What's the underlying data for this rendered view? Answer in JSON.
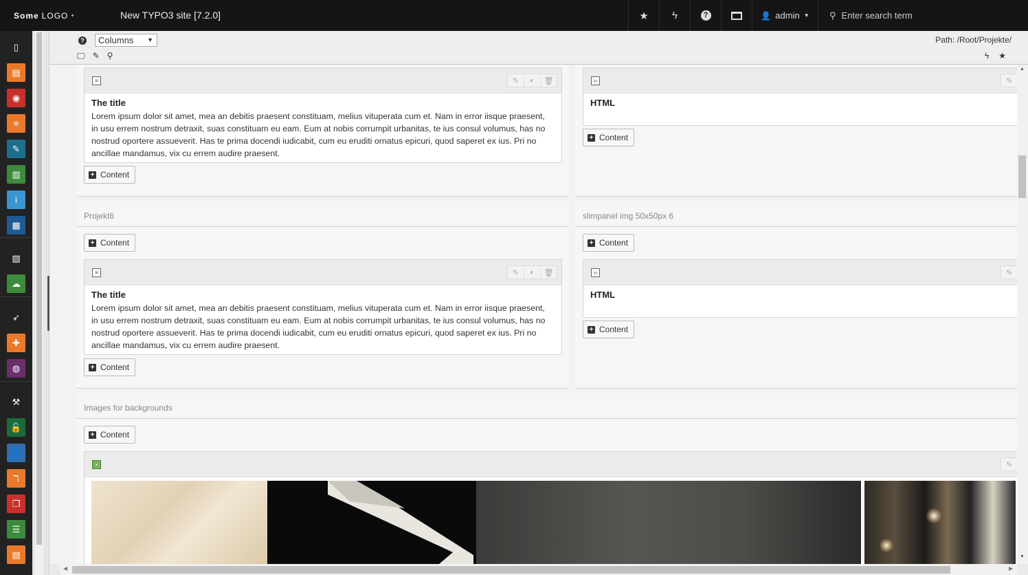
{
  "topbar": {
    "logo_bold": "Some",
    "logo_rest": "LOGO",
    "logo_mark": "+",
    "site_title": "New TYPO3 site [7.2.0]",
    "icons": [
      "star-icon",
      "bolt-icon",
      "help-icon",
      "list-icon"
    ],
    "user_name": "admin",
    "search_placeholder": "Enter search term"
  },
  "docheader": {
    "help": "?",
    "view_select": "Columns",
    "path": "Path: /Root/Projekte/",
    "left_icons": [
      "desktop-icon",
      "pencil-icon",
      "search-icon"
    ],
    "right_icons": [
      "bolt-icon",
      "star-icon"
    ]
  },
  "modules": [
    {
      "name": "page-module",
      "color": "#ffffff",
      "bg": "#222222",
      "glyph": "▯"
    },
    {
      "name": "view-module",
      "color": "#ffffff",
      "bg": "#e97a2b",
      "glyph": "▤"
    },
    {
      "name": "preview-module",
      "color": "#ffffff",
      "bg": "#c9302c",
      "glyph": "◉"
    },
    {
      "name": "list-module",
      "color": "#ffffff",
      "bg": "#e97a2b",
      "glyph": "≡"
    },
    {
      "name": "wizard-module",
      "color": "#ffffff",
      "bg": "#1e6e8c",
      "glyph": "✎"
    },
    {
      "name": "reports-module",
      "color": "#ffffff",
      "bg": "#3d8b3d",
      "glyph": "▥"
    },
    {
      "name": "info-module",
      "color": "#ffffff",
      "bg": "#3a95d1",
      "glyph": "i"
    },
    {
      "name": "template-module",
      "color": "#ffffff",
      "bg": "#1e5b94",
      "glyph": "▦"
    },
    {
      "name": "filelist-module",
      "color": "#ffffff",
      "bg": "#222222",
      "glyph": "▨"
    },
    {
      "name": "cloud-module",
      "color": "#ffffff",
      "bg": "#3d8b3d",
      "glyph": "☁"
    },
    {
      "name": "launch-module",
      "color": "#ffffff",
      "bg": "#222222",
      "glyph": "➶"
    },
    {
      "name": "extension-module",
      "color": "#ffffff",
      "bg": "#e97a2b",
      "glyph": "✚"
    },
    {
      "name": "globe-module",
      "color": "#ffffff",
      "bg": "#6b2f6b",
      "glyph": "◍"
    },
    {
      "name": "plugin-module",
      "color": "#ffffff",
      "bg": "#222222",
      "glyph": "⚒"
    },
    {
      "name": "access-module",
      "color": "#ffffff",
      "bg": "#1b6b3b",
      "glyph": "🔓"
    },
    {
      "name": "users-module",
      "color": "#ffffff",
      "bg": "#2f6fb0",
      "glyph": "👤"
    },
    {
      "name": "typo3-module",
      "color": "#ffffff",
      "bg": "#e97a2b",
      "glyph": "ℸ"
    },
    {
      "name": "docs-module",
      "color": "#ffffff",
      "bg": "#c9302c",
      "glyph": "❐"
    },
    {
      "name": "db-module",
      "color": "#ffffff",
      "bg": "#3d8b3d",
      "glyph": "☰"
    },
    {
      "name": "notes-module",
      "color": "#ffffff",
      "bg": "#e97a2b",
      "glyph": "▤"
    }
  ],
  "row1": {
    "left": {
      "ce_title": "The title",
      "ce_body": "Lorem ipsum dolor sit amet, mea an debitis praesent constituam, melius vituperata cum et. Nam in error iisque praesent, in usu errem nostrum detraxit, suas constituam eu eam. Eum at nobis corrumpit urbanitas, te ius consul volumus, has no nostrud oportere assueverit. Has te prima docendi iudicabit, cum eu eruditi ornatus epicuri, quod saperet ex ius. Pri no ancillae mandamus, vix cu errem audire praesent.",
      "btn": "Content"
    },
    "right": {
      "ce_title": "HTML",
      "btn": "Content"
    }
  },
  "row2": {
    "left": {
      "col_title": "Projekt6",
      "btn_top": "Content",
      "ce_title": "The title",
      "ce_body": "Lorem ipsum dolor sit amet, mea an debitis praesent constituam, melius vituperata cum et. Nam in error iisque praesent, in usu errem nostrum detraxit, suas constituam eu eam. Eum at nobis corrumpit urbanitas, te ius consul volumus, has no nostrud oportere assueverit. Has te prima docendi iudicabit, cum eu eruditi ornatus epicuri, quod saperet ex ius. Pri no ancillae mandamus, vix cu errem audire praesent.",
      "btn": "Content"
    },
    "right": {
      "col_title": "slimpanel img 50x50px 6",
      "btn_top": "Content",
      "ce_title": "HTML",
      "btn": "Content"
    }
  },
  "row3": {
    "col_title": "Images for backgrounds",
    "btn_top": "Content"
  },
  "colors": {
    "topbar": "#151515",
    "modmenu": "#222222",
    "content_bg": "#f2f2f2"
  }
}
